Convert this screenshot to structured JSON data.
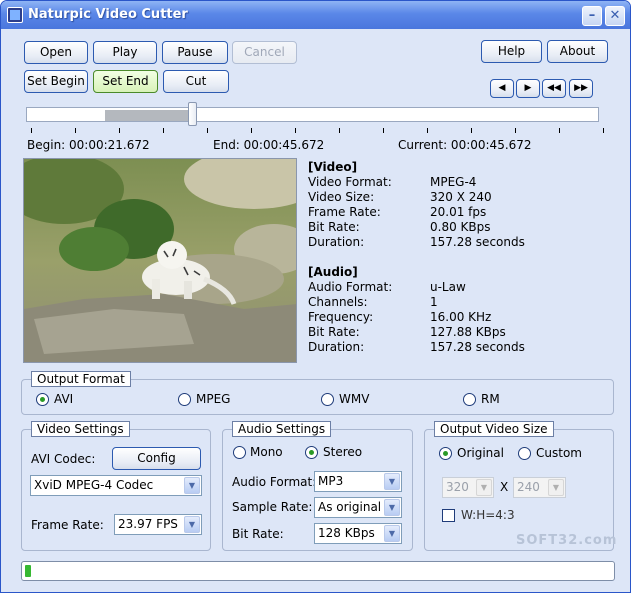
{
  "window": {
    "title": "Naturpic Video Cutter",
    "minimize_icon": "minimize-icon",
    "close_icon": "close-icon"
  },
  "toolbar": {
    "open": "Open",
    "play": "Play",
    "pause": "Pause",
    "cancel": "Cancel",
    "help": "Help",
    "about": "About",
    "set_begin": "Set Begin",
    "set_end": "Set End",
    "cut": "Cut",
    "nav_prev": "◀",
    "nav_next": "▶",
    "nav_rewind": "◀◀",
    "nav_forward": "▶▶"
  },
  "timeline": {
    "selection_start_fraction": 0.138,
    "selection_end_fraction": 0.29,
    "begin": "Begin: 00:00:21.672",
    "end": "End: 00:00:45.672",
    "current": "Current: 00:00:45.672"
  },
  "video_info": {
    "header": "[Video]",
    "rows": [
      {
        "key": "Video Format:",
        "value": "MPEG-4"
      },
      {
        "key": "Video Size:",
        "value": "320 X 240"
      },
      {
        "key": "Frame Rate:",
        "value": "20.01 fps"
      },
      {
        "key": "Bit Rate:",
        "value": "0.80 KBps"
      },
      {
        "key": "Duration:",
        "value": "157.28 seconds"
      }
    ]
  },
  "audio_info": {
    "header": "[Audio]",
    "rows": [
      {
        "key": "Audio Format:",
        "value": "u-Law"
      },
      {
        "key": "Channels:",
        "value": "1"
      },
      {
        "key": "Frequency:",
        "value": "16.00 KHz"
      },
      {
        "key": "Bit Rate:",
        "value": "127.88 KBps"
      },
      {
        "key": "Duration:",
        "value": "157.28 seconds"
      }
    ]
  },
  "output_format": {
    "title": "Output Format",
    "options": [
      "AVI",
      "MPEG",
      "WMV",
      "RM"
    ],
    "selected": "AVI"
  },
  "video_settings": {
    "title": "Video Settings",
    "codec_label": "AVI Codec:",
    "config_button": "Config",
    "codec_value": "XviD MPEG-4 Codec",
    "frame_rate_label": "Frame Rate:",
    "frame_rate_value": "23.97 FPS"
  },
  "audio_settings": {
    "title": "Audio Settings",
    "mono": "Mono",
    "stereo": "Stereo",
    "selected": "Stereo",
    "format_label": "Audio Format:",
    "format_value": "MP3",
    "sample_rate_label": "Sample Rate:",
    "sample_rate_value": "As original",
    "bit_rate_label": "Bit Rate:",
    "bit_rate_value": "128 KBps"
  },
  "output_size": {
    "title": "Output Video Size",
    "original": "Original",
    "custom": "Custom",
    "selected": "Original",
    "width_value": "320",
    "by": "X",
    "height_value": "240",
    "ratio_label": "W:H=4:3"
  },
  "progress": {
    "fraction": 0.01
  },
  "watermark": "SOFT32.com",
  "colors": {
    "titlebar": "#4a76dd",
    "accent_green": "#36b832",
    "panel_bg": "#dde6f7"
  }
}
